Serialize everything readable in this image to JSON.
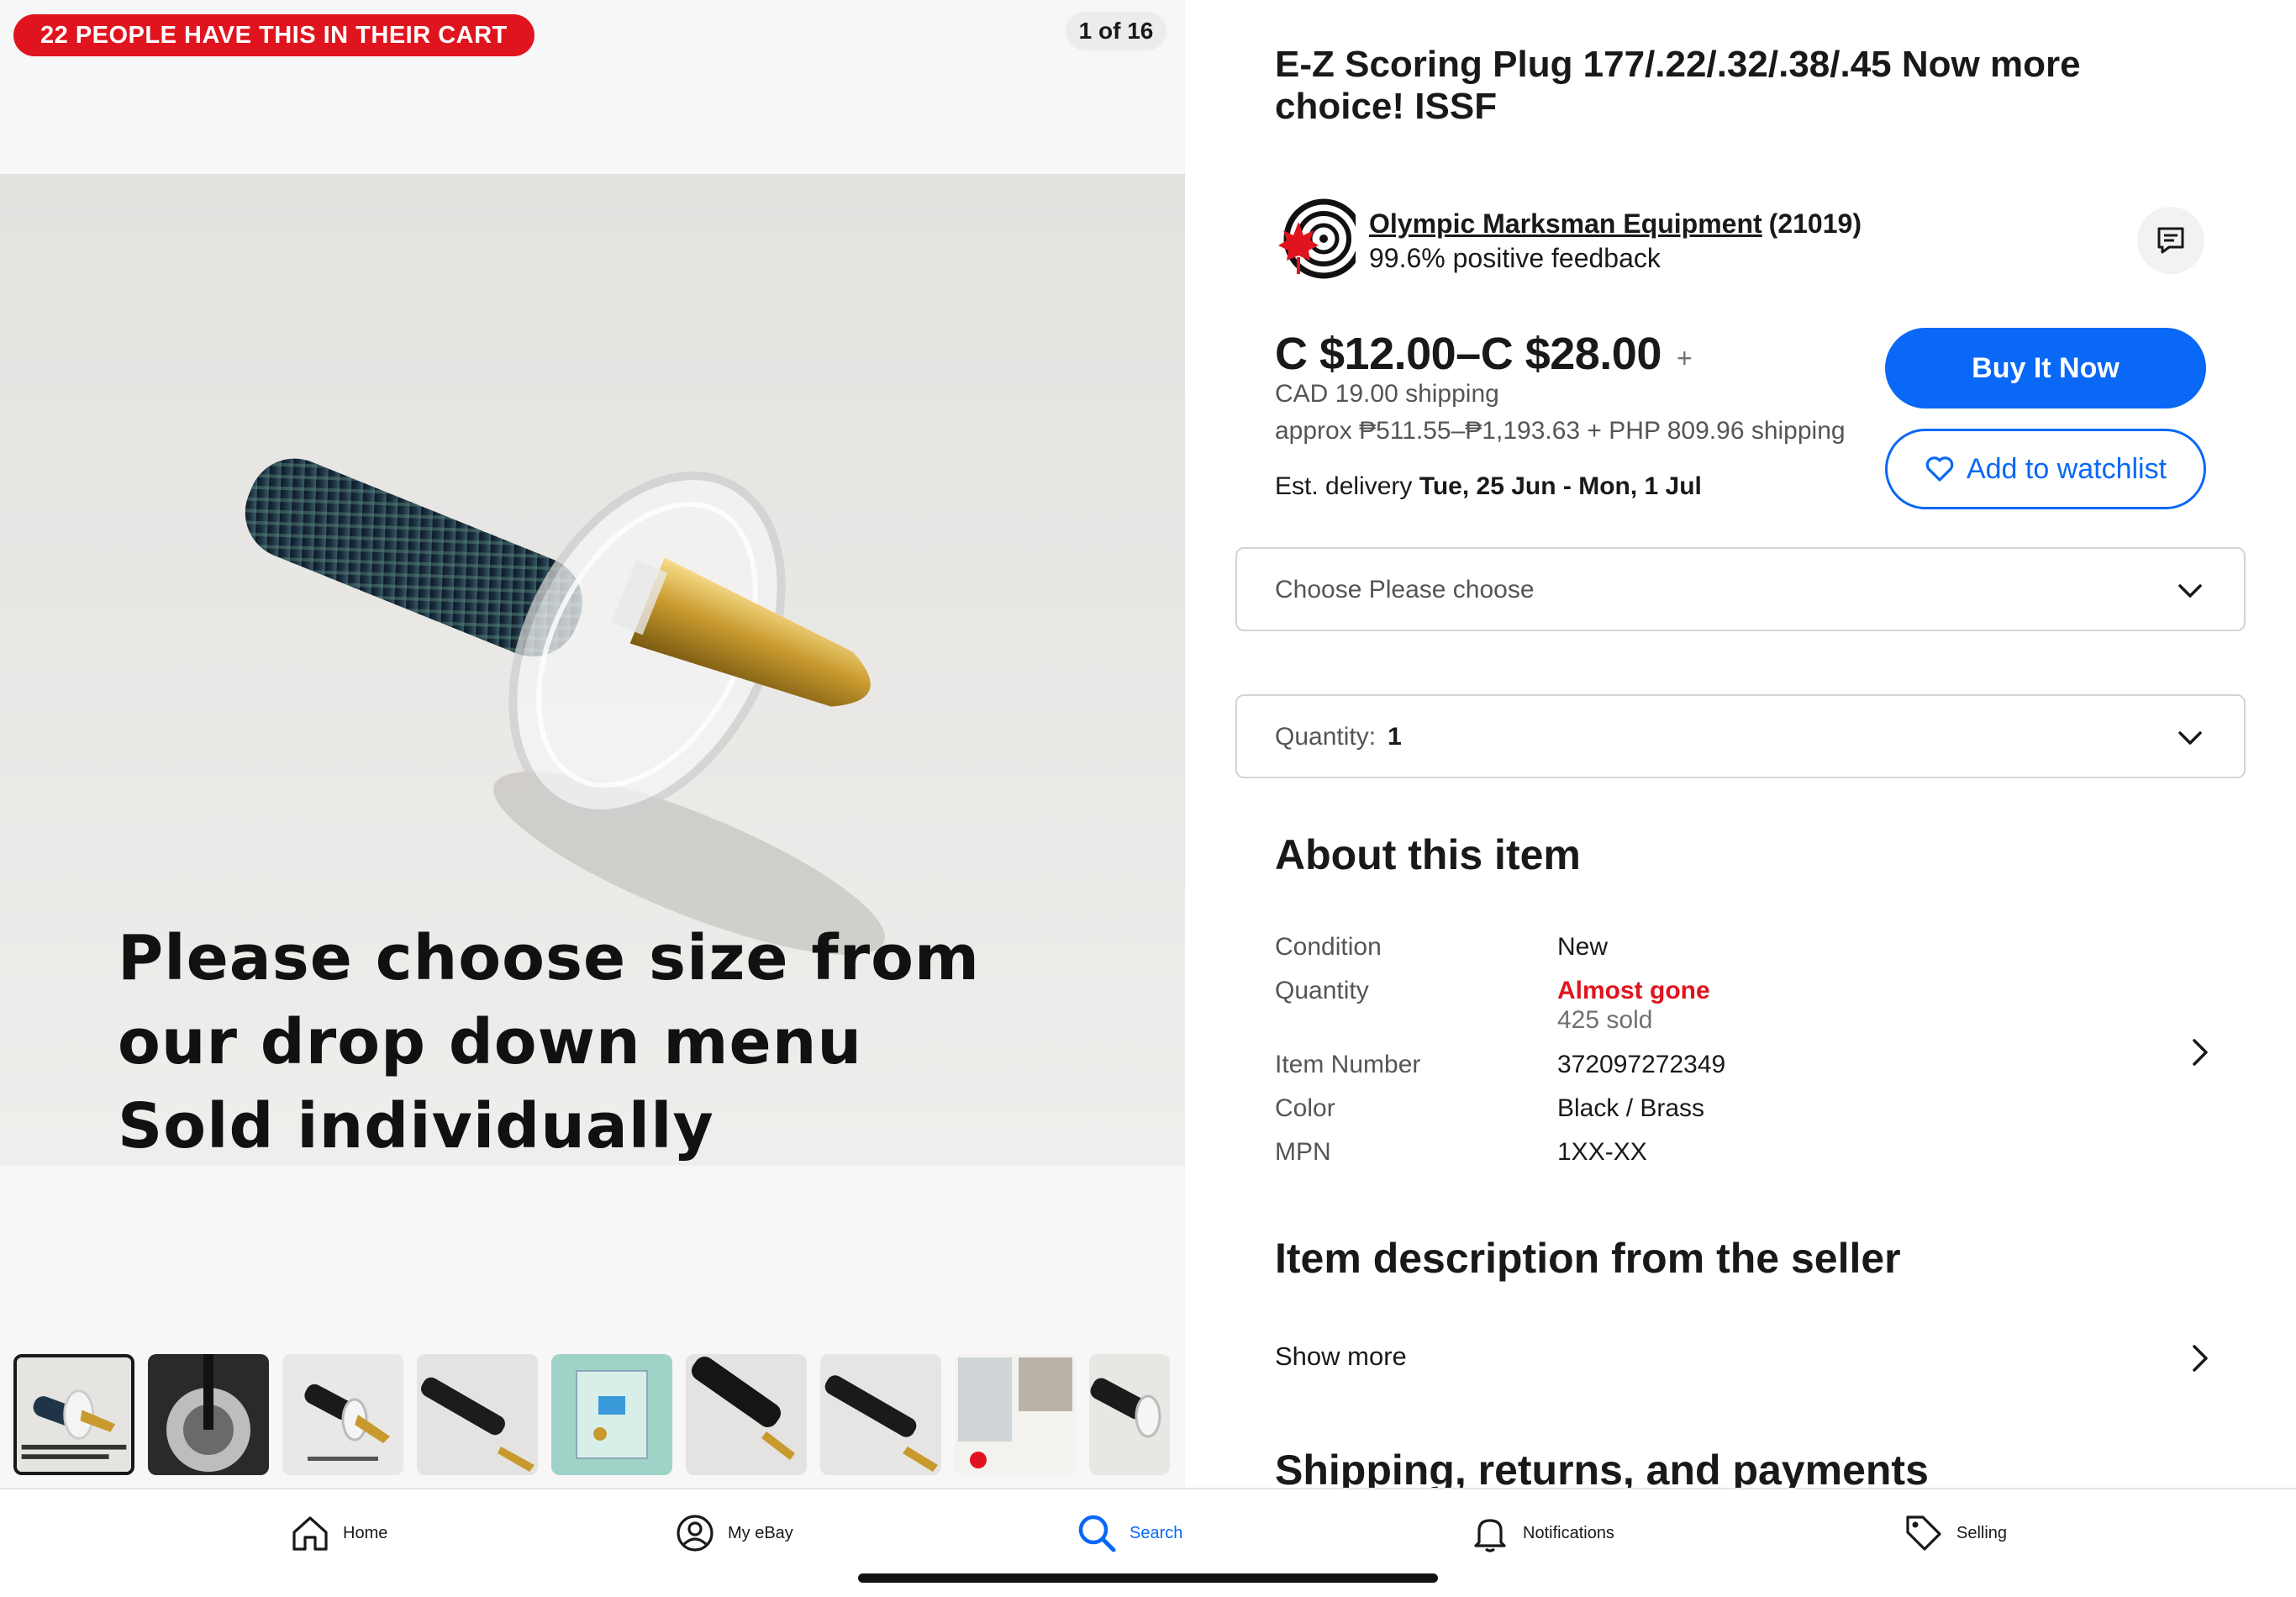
{
  "gallery": {
    "cart_badge": "22 PEOPLE HAVE THIS IN THEIR CART",
    "counter": "1 of 16",
    "caption": [
      "Please choose size from",
      "our drop down menu",
      "Sold individually"
    ],
    "thumbnail_count": 9
  },
  "listing": {
    "title": "E-Z Scoring Plug 177/.22/.32/.38/.45 Now more choice! ISSF",
    "seller": {
      "name": "Olympic Marksman Equipment",
      "count": "(21019)",
      "feedback": "99.6% positive feedback"
    },
    "price": "C $12.00–C $28.00",
    "price_plus": "+",
    "shipping": "CAD 19.00 shipping",
    "approx": "approx ₱511.55–₱1,193.63 + PHP 809.96 shipping",
    "delivery_label": "Est. delivery",
    "delivery_dates": "Tue, 25 Jun - Mon, 1 Jul",
    "buy_label": "Buy It Now",
    "watch_label": "Add to watchlist",
    "choose_label": "Choose Please choose",
    "quantity_label": "Quantity:",
    "quantity_value": "1"
  },
  "about": {
    "heading": "About this item",
    "specs": {
      "condition_label": "Condition",
      "condition_value": "New",
      "quantity_label": "Quantity",
      "quantity_value": "Almost gone",
      "quantity_sold": "425 sold",
      "item_number_label": "Item Number",
      "item_number_value": "372097272349",
      "color_label": "Color",
      "color_value": "Black / Brass",
      "mpn_label": "MPN",
      "mpn_value": "1XX-XX"
    }
  },
  "description": {
    "heading": "Item description from the seller",
    "show_more": "Show more"
  },
  "shipping_section": {
    "heading": "Shipping, returns, and payments"
  },
  "tabbar": {
    "home": "Home",
    "my_ebay": "My eBay",
    "search": "Search",
    "notifications": "Notifications",
    "selling": "Selling"
  },
  "colors": {
    "accent": "#0968f6",
    "alert": "#e0141e",
    "text": "#191919",
    "muted": "#555555"
  },
  "icons": [
    "chat-icon",
    "heart-icon",
    "chevron-down-icon",
    "chevron-right-icon",
    "home-icon",
    "user-icon",
    "search-icon",
    "bell-icon",
    "tag-icon"
  ]
}
